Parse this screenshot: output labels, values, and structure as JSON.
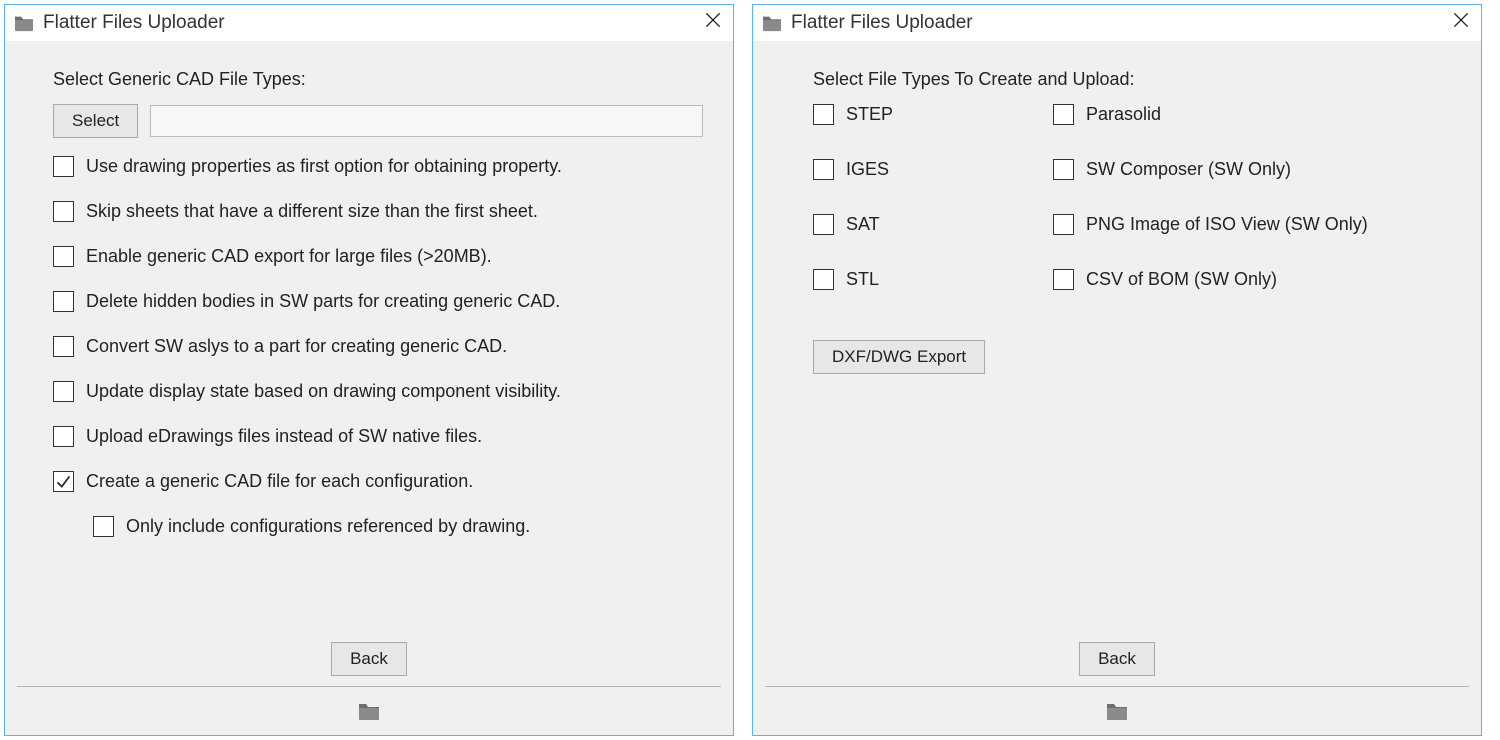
{
  "left": {
    "title": "Flatter Files Uploader",
    "section_label": "Select Generic CAD File Types:",
    "select_button": "Select",
    "options": [
      {
        "label": "Use drawing properties as first option for obtaining property.",
        "checked": false,
        "name": "opt-drawing-properties"
      },
      {
        "label": "Skip sheets that have a different size than the first sheet.",
        "checked": false,
        "name": "opt-skip-sheets"
      },
      {
        "label": "Enable generic CAD export for large files (>20MB).",
        "checked": false,
        "name": "opt-enable-large"
      },
      {
        "label": "Delete hidden bodies in SW parts for creating generic CAD.",
        "checked": false,
        "name": "opt-delete-hidden"
      },
      {
        "label": "Convert SW aslys to a part for creating generic CAD.",
        "checked": false,
        "name": "opt-convert-asm"
      },
      {
        "label": "Update display state based on drawing component visibility.",
        "checked": false,
        "name": "opt-update-display"
      },
      {
        "label": "Upload eDrawings files instead of SW native files.",
        "checked": false,
        "name": "opt-upload-edrawings"
      },
      {
        "label": "Create a generic CAD file for each configuration.",
        "checked": true,
        "name": "opt-create-each-config"
      }
    ],
    "sub_option": {
      "label": "Only include configurations referenced by drawing.",
      "checked": false,
      "name": "opt-only-referenced"
    },
    "back_button": "Back"
  },
  "right": {
    "title": "Flatter Files Uploader",
    "section_label": "Select File Types To Create and Upload:",
    "filetypes": [
      {
        "label": "STEP",
        "checked": false,
        "name": "ft-step"
      },
      {
        "label": "Parasolid",
        "checked": false,
        "name": "ft-parasolid"
      },
      {
        "label": "IGES",
        "checked": false,
        "name": "ft-iges"
      },
      {
        "label": "SW Composer (SW Only)",
        "checked": false,
        "name": "ft-sw-composer"
      },
      {
        "label": "SAT",
        "checked": false,
        "name": "ft-sat"
      },
      {
        "label": "PNG Image of ISO View (SW Only)",
        "checked": false,
        "name": "ft-png-iso"
      },
      {
        "label": "STL",
        "checked": false,
        "name": "ft-stl"
      },
      {
        "label": "CSV of BOM (SW Only)",
        "checked": false,
        "name": "ft-csv-bom"
      }
    ],
    "dxf_button": "DXF/DWG Export",
    "back_button": "Back"
  }
}
